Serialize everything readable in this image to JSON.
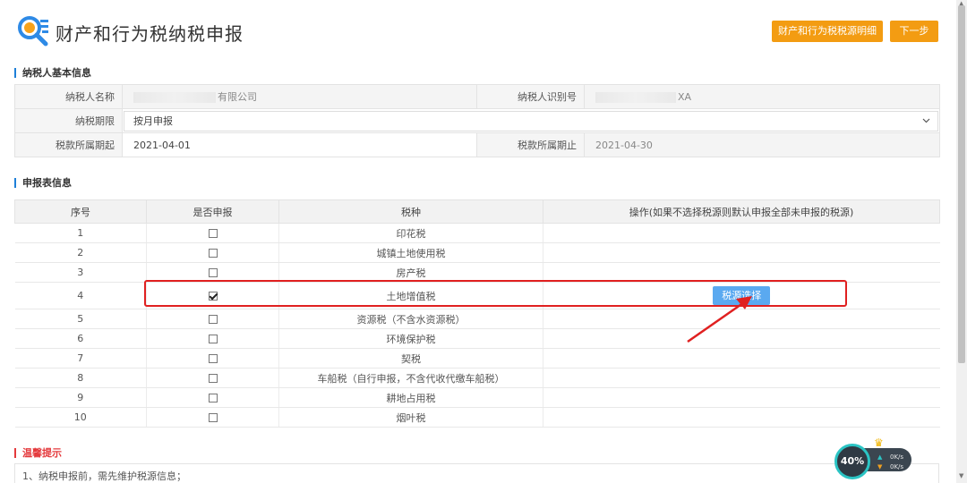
{
  "header": {
    "title": "财产和行为税纳税申报",
    "detail_button": "财产和行为税税源明细",
    "next_button": "下一步"
  },
  "taxpayer_section": {
    "title": "纳税人基本信息",
    "name_label": "纳税人名称",
    "name_value_suffix": "有限公司",
    "id_label": "纳税人识别号",
    "id_value_suffix": "XA",
    "period_label": "纳税期限",
    "period_value": "按月申报",
    "start_label": "税款所属期起",
    "start_value": "2021-04-01",
    "end_label": "税款所属期止",
    "end_value": "2021-04-30"
  },
  "declaration_section": {
    "title": "申报表信息",
    "columns": [
      "序号",
      "是否申报",
      "税种",
      "操作(如果不选择税源则默认申报全部未申报的税源)"
    ],
    "rows": [
      {
        "no": "1",
        "checked": false,
        "tax": "印花税"
      },
      {
        "no": "2",
        "checked": false,
        "tax": "城镇土地使用税"
      },
      {
        "no": "3",
        "checked": false,
        "tax": "房产税"
      },
      {
        "no": "4",
        "checked": true,
        "tax": "土地增值税",
        "action": "税源选择"
      },
      {
        "no": "5",
        "checked": false,
        "tax": "资源税（不含水资源税）"
      },
      {
        "no": "6",
        "checked": false,
        "tax": "环境保护税"
      },
      {
        "no": "7",
        "checked": false,
        "tax": "契税"
      },
      {
        "no": "8",
        "checked": false,
        "tax": "车船税（自行申报，不含代收代缴车船税）"
      },
      {
        "no": "9",
        "checked": false,
        "tax": "耕地占用税"
      },
      {
        "no": "10",
        "checked": false,
        "tax": "烟叶税"
      }
    ]
  },
  "tips_section": {
    "title": "温馨提示",
    "line1": "1、纳税申报前，需先维护税源信息；"
  },
  "net_widget": {
    "percent": "40%",
    "up_rate": "0K/s",
    "down_rate": "0K/s"
  },
  "colors": {
    "accent_orange": "#f39c12",
    "section_blue": "#1e7fd8",
    "warn_red": "#e4393c",
    "source_button_blue": "#5aa9f0",
    "annotation_red": "#e02020"
  }
}
